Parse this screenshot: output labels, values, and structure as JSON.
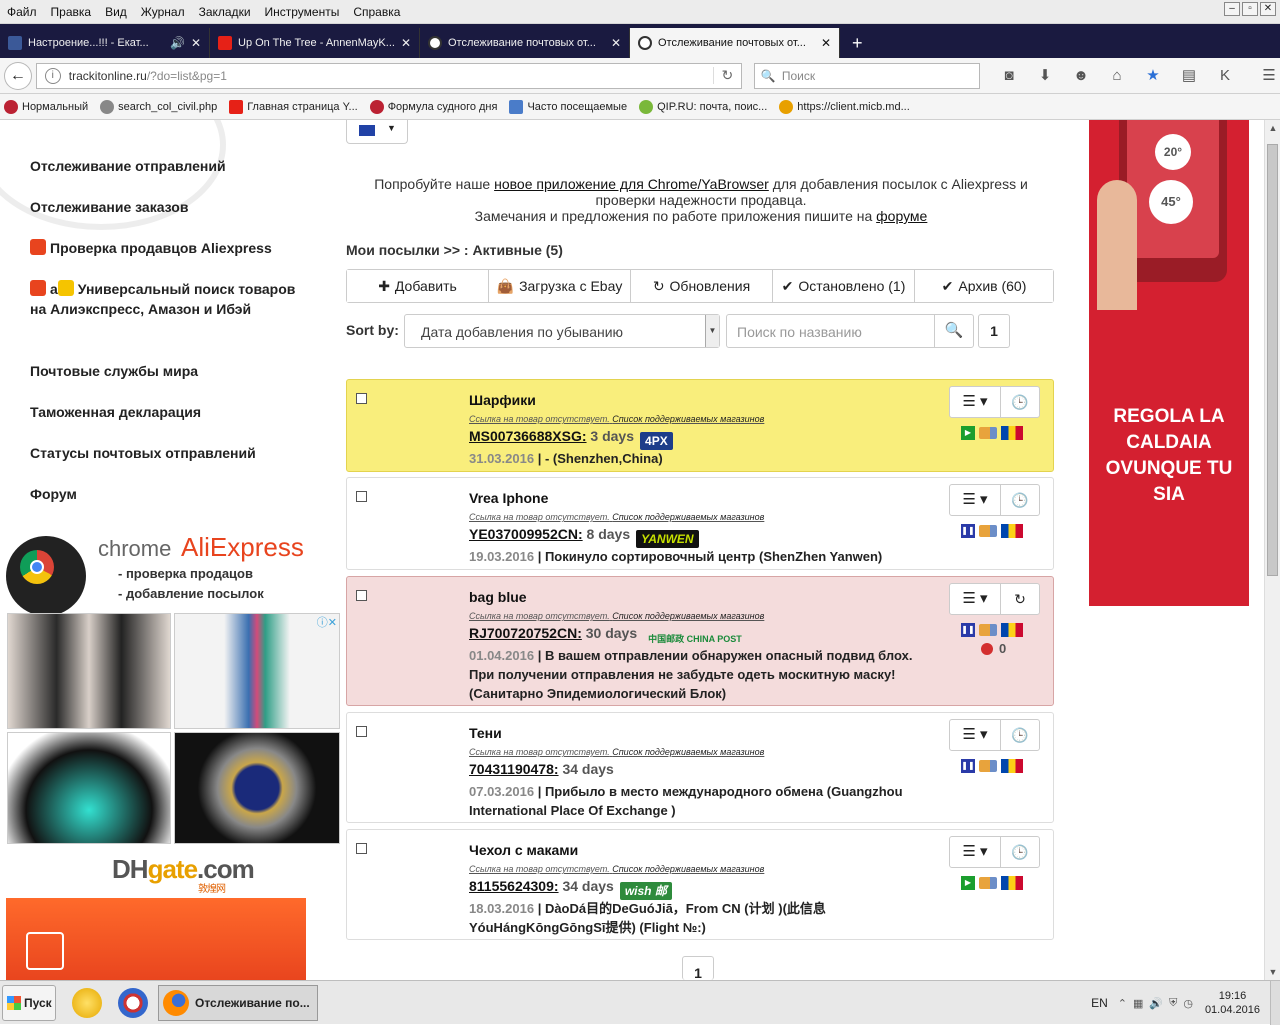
{
  "menubar": {
    "items": [
      "Файл",
      "Правка",
      "Вид",
      "Журнал",
      "Закладки",
      "Инструменты",
      "Справка"
    ]
  },
  "tabs": [
    {
      "title": "Настроение...!!! - Екат...",
      "color": "#3b5998"
    },
    {
      "title": "Up On The Tree - AnnenMayK...",
      "color": "#e62117"
    },
    {
      "title": "Отслеживание почтовых от...",
      "color": "#ffffff"
    },
    {
      "title": "Отслеживание почтовых от...",
      "color": "#ffffff"
    }
  ],
  "address": {
    "host": "trackitonline.ru",
    "path": "/?do=list&pg=1",
    "search_placeholder": "Поиск"
  },
  "bookmarks": [
    "Нормальный",
    "search_col_civil.php",
    "Главная страница Y...",
    "Формула судного дня",
    "Часто посещаемые",
    "QIP.RU: почта, поис...",
    "https://client.micb.md..."
  ],
  "sidebar": {
    "items": [
      "Отслеживание отправлений",
      "Отслеживание заказов",
      "Проверка продавцов Aliexpress",
      "Универсальный поиск товаров на Алиэкспресс, Амазон и Ибэй",
      "Почтовые службы мира",
      "Таможенная декларация",
      "Статусы почтовых отправлений",
      "Форум"
    ],
    "promo": {
      "chrome": "chrome",
      "aliexpress": "AliExpress",
      "line1": "- проверка продацов",
      "line2": "- добавление посылок"
    },
    "dhgate": {
      "dh": "DH",
      "gate": "gate",
      "com": ".com",
      "cn": "敦煌网"
    }
  },
  "notice": {
    "pre": "Попробуйте наше ",
    "link": "новое приложение для Chrome/YaBrowser",
    "post": " для добавления посылок с Aliexpress и проверки надежности продавца.",
    "line2": "Замечания и предложения по работе приложения пишите на ",
    "forum": "форуме"
  },
  "breadcrumb": "Мои посылки >> : Активные (5)",
  "actions": {
    "add": "Добавить",
    "ebay": "Загрузка с Ebay",
    "updates": "Обновления",
    "stopped": "Остановлено (1)",
    "archive": "Архив (60)"
  },
  "sort": {
    "label": "Sort by:",
    "value": "Дата добавления по убыванию",
    "search_placeholder": "Поиск по названию",
    "page": "1"
  },
  "parcels": [
    {
      "name": "Шарфики",
      "links": [
        "Ссылка на товар отсутствует.",
        "Список поддерживаемых магазинов"
      ],
      "track": "MS00736688XSG:",
      "days": "3 days",
      "carrier": "4PX",
      "date": "31.03.2016",
      "status": " | - (Shenzhen,China)"
    },
    {
      "name": "Vrea Iphone",
      "links": [
        "Ссылка на товар отсутствует.",
        "Список поддерживаемых магазинов"
      ],
      "track": "YE037009952CN:",
      "days": "8 days",
      "carrier": "YANWEN",
      "date": "19.03.2016",
      "status": " | Покинуло сортировочный центр (ShenZhen Yanwen)"
    },
    {
      "name": "bag blue",
      "links": [
        "Ссылка на товар отсутствует.",
        "Список поддерживаемых магазинов"
      ],
      "track": "RJ700720752CN:",
      "days": "30 days",
      "carrier": "中国邮政 CHINA POST",
      "date": "01.04.2016",
      "status": " | В вашем отправлении обнаружен опасный подвид блох. При получении отправления не забудьте одеть москитную маску! (Санитарно Эпидемиологический Блок)",
      "blocked_count": "0"
    },
    {
      "name": "Тени",
      "links": [
        "Ссылка на товар отсутствует.",
        "Список поддерживаемых магазинов"
      ],
      "track": "70431190478:",
      "days": "34 days",
      "carrier": "",
      "date": "07.03.2016",
      "status": " | Прибыло в место международного обмена (Guangzhou International Place Of Exchange )"
    },
    {
      "name": "Чехол с маками",
      "links": [
        "Ссылка на товар отсутствует.",
        "Список поддерживаемых магазинов"
      ],
      "track": "81155624309:",
      "days": "34 days",
      "carrier": "wish 邮",
      "date": "18.03.2016",
      "status": " | DàoDá目的DeGuóJiā，From CN (计划 )(此信息YóuHángKōngGōngSī提供) (Flight №:)"
    }
  ],
  "pager": "1",
  "right_ad": {
    "dial1": "20°",
    "dial2": "45°",
    "text": "REGOLA LA CALDAIA OVUNQUE TU SIA"
  },
  "taskbar": {
    "start": "Пуск",
    "window": "Отслеживание по...",
    "lang": "EN",
    "time": "19:16",
    "date": "01.04.2016"
  }
}
